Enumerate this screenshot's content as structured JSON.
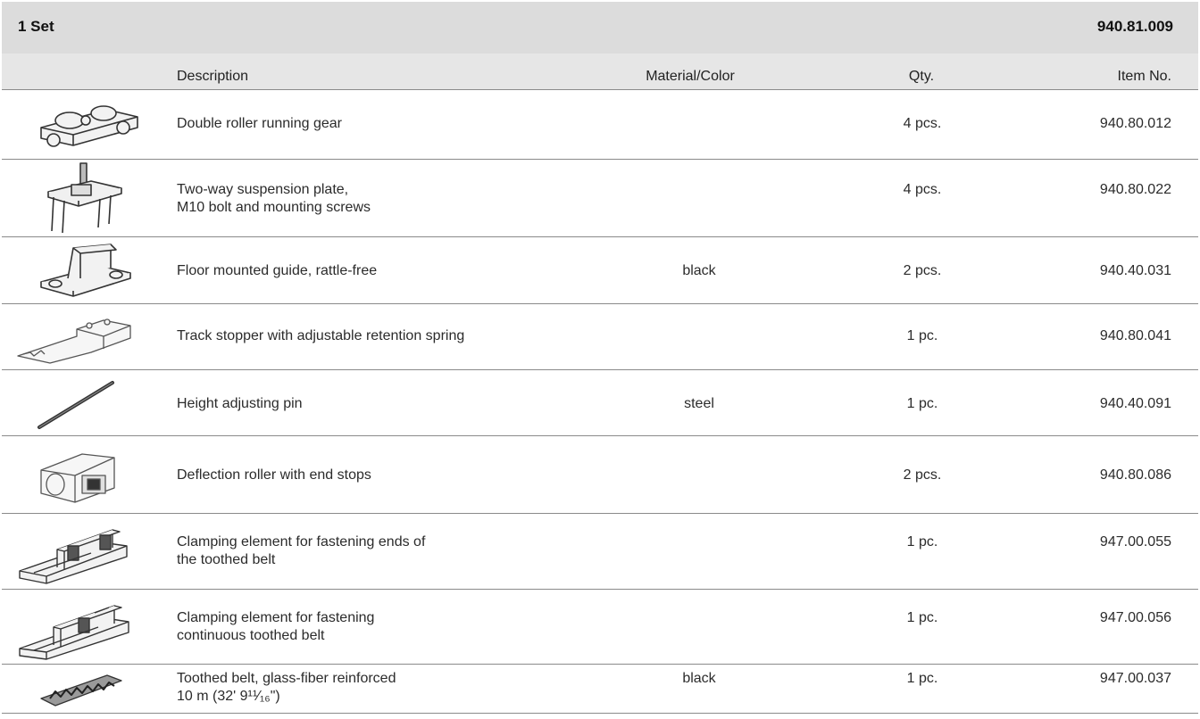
{
  "set": {
    "title": "1 Set",
    "number": "940.81.009"
  },
  "columns": {
    "description": "Description",
    "material": "Material/Color",
    "qty": "Qty.",
    "item": "Item No."
  },
  "rows": [
    {
      "icon": "double-roller-running-gear-icon",
      "desc1": "Double roller running gear",
      "desc2": "",
      "material": "",
      "qty": "4 pcs.",
      "item": "940.80.012"
    },
    {
      "icon": "suspension-plate-icon",
      "desc1": "Two-way suspension plate,",
      "desc2": "M10 bolt and mounting screws",
      "material": "",
      "qty": "4 pcs.",
      "item": "940.80.022"
    },
    {
      "icon": "floor-guide-icon",
      "desc1": "Floor mounted guide, rattle-free",
      "desc2": "",
      "material": "black",
      "qty": "2 pcs.",
      "item": "940.40.031"
    },
    {
      "icon": "track-stopper-icon",
      "desc1": "Track stopper with adjustable retention spring",
      "desc2": "",
      "material": "",
      "qty": "1 pc.",
      "item": "940.80.041"
    },
    {
      "icon": "adjusting-pin-icon",
      "desc1": "Height adjusting pin",
      "desc2": "",
      "material": "steel",
      "qty": "1 pc.",
      "item": "940.40.091"
    },
    {
      "icon": "deflection-roller-icon",
      "desc1": "Deflection roller with end stops",
      "desc2": "",
      "material": "",
      "qty": "2 pcs.",
      "item": "940.80.086"
    },
    {
      "icon": "clamping-element-ends-icon",
      "desc1": "Clamping element for fastening ends of",
      "desc2": "the toothed belt",
      "material": "",
      "qty": "1 pc.",
      "item": "947.00.055"
    },
    {
      "icon": "clamping-element-continuous-icon",
      "desc1": "Clamping element for fastening",
      "desc2": "continuous toothed belt",
      "material": "",
      "qty": "1 pc.",
      "item": "947.00.056"
    },
    {
      "icon": "toothed-belt-icon",
      "desc1": "Toothed belt, glass-fiber reinforced",
      "desc2": "10 m (32' 9¹¹⁄₁₆\")",
      "material": "black",
      "qty": "1 pc.",
      "item": "947.00.037"
    }
  ]
}
